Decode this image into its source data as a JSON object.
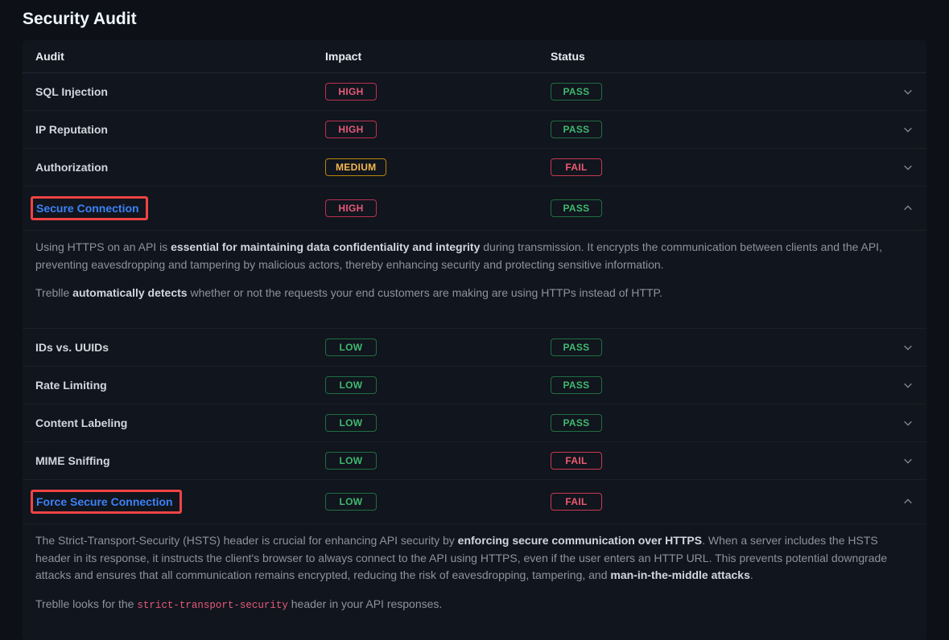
{
  "title": "Security Audit",
  "columns": {
    "audit": "Audit",
    "impact": "Impact",
    "status": "Status"
  },
  "rows": [
    {
      "name": "SQL Injection",
      "impact": "HIGH",
      "impact_class": "impact-high",
      "status": "PASS",
      "status_class": "status-pass",
      "expanded": false,
      "highlighted": false
    },
    {
      "name": "IP Reputation",
      "impact": "HIGH",
      "impact_class": "impact-high",
      "status": "PASS",
      "status_class": "status-pass",
      "expanded": false,
      "highlighted": false
    },
    {
      "name": "Authorization",
      "impact": "MEDIUM",
      "impact_class": "impact-medium",
      "status": "FAIL",
      "status_class": "status-fail",
      "expanded": false,
      "highlighted": false
    },
    {
      "name": "Secure Connection",
      "impact": "HIGH",
      "impact_class": "impact-high",
      "status": "PASS",
      "status_class": "status-pass",
      "expanded": true,
      "highlighted": true,
      "detail": [
        {
          "segments": [
            {
              "t": "Using HTTPS on an API is "
            },
            {
              "t": "essential for maintaining data confidentiality and integrity",
              "strong": true
            },
            {
              "t": " during transmission. It encrypts the communication between clients and the API, preventing eavesdropping and tampering by malicious actors, thereby enhancing security and protecting sensitive information."
            }
          ]
        },
        {
          "segments": [
            {
              "t": "Treblle "
            },
            {
              "t": "automatically detects",
              "strong": true
            },
            {
              "t": " whether or not the requests your end customers are making are using HTTPs instead of HTTP."
            }
          ]
        }
      ]
    },
    {
      "name": "IDs vs. UUIDs",
      "impact": "LOW",
      "impact_class": "impact-low",
      "status": "PASS",
      "status_class": "status-pass",
      "expanded": false,
      "highlighted": false
    },
    {
      "name": "Rate Limiting",
      "impact": "LOW",
      "impact_class": "impact-low",
      "status": "PASS",
      "status_class": "status-pass",
      "expanded": false,
      "highlighted": false
    },
    {
      "name": "Content Labeling",
      "impact": "LOW",
      "impact_class": "impact-low",
      "status": "PASS",
      "status_class": "status-pass",
      "expanded": false,
      "highlighted": false
    },
    {
      "name": "MIME Sniffing",
      "impact": "LOW",
      "impact_class": "impact-low",
      "status": "FAIL",
      "status_class": "status-fail",
      "expanded": false,
      "highlighted": false
    },
    {
      "name": "Force Secure Connection",
      "impact": "LOW",
      "impact_class": "impact-low",
      "status": "FAIL",
      "status_class": "status-fail",
      "expanded": true,
      "highlighted": true,
      "detail": [
        {
          "segments": [
            {
              "t": "The Strict-Transport-Security (HSTS) header is crucial for enhancing API security by "
            },
            {
              "t": "enforcing secure communication over HTTPS",
              "strong": true
            },
            {
              "t": ". When a server includes the HSTS header in its response, it instructs the client's browser to always connect to the API using HTTPS, even if the user enters an HTTP URL. This prevents potential downgrade attacks and ensures that all communication remains encrypted, reducing the risk of eavesdropping, tampering, and "
            },
            {
              "t": "man-in-the-middle attacks",
              "strong": true
            },
            {
              "t": "."
            }
          ]
        },
        {
          "segments": [
            {
              "t": "Treblle looks for the "
            },
            {
              "t": "strict-transport-security",
              "code": true
            },
            {
              "t": " header in your API responses."
            }
          ]
        }
      ]
    }
  ]
}
